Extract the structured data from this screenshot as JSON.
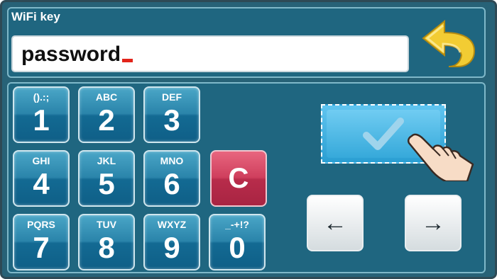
{
  "header": {
    "title": "WiFi key",
    "input_value": "password"
  },
  "keypad": {
    "keys": [
      {
        "digit": "1",
        "letters": "().:;"
      },
      {
        "digit": "2",
        "letters": "ABC"
      },
      {
        "digit": "3",
        "letters": "DEF"
      },
      {
        "digit": "4",
        "letters": "GHI"
      },
      {
        "digit": "5",
        "letters": "JKL"
      },
      {
        "digit": "6",
        "letters": "MNO"
      },
      {
        "digit": "7",
        "letters": "PQRS"
      },
      {
        "digit": "8",
        "letters": "TUV"
      },
      {
        "digit": "9",
        "letters": "WXYZ"
      },
      {
        "digit": "0",
        "letters": "_-+!?"
      }
    ],
    "clear_label": "C"
  },
  "nav": {
    "left_arrow": "←",
    "right_arrow": "→"
  },
  "icons": {
    "back": "back-arrow-icon",
    "confirm": "checkmark-icon",
    "hand": "pointing-hand-icon"
  },
  "colors": {
    "panel": "#1f6680",
    "key": "#2a84aa",
    "clear": "#cf3f5d",
    "confirm": "#3aaedd",
    "caret": "#e2241a",
    "back_arrow": "#f2cc33"
  }
}
